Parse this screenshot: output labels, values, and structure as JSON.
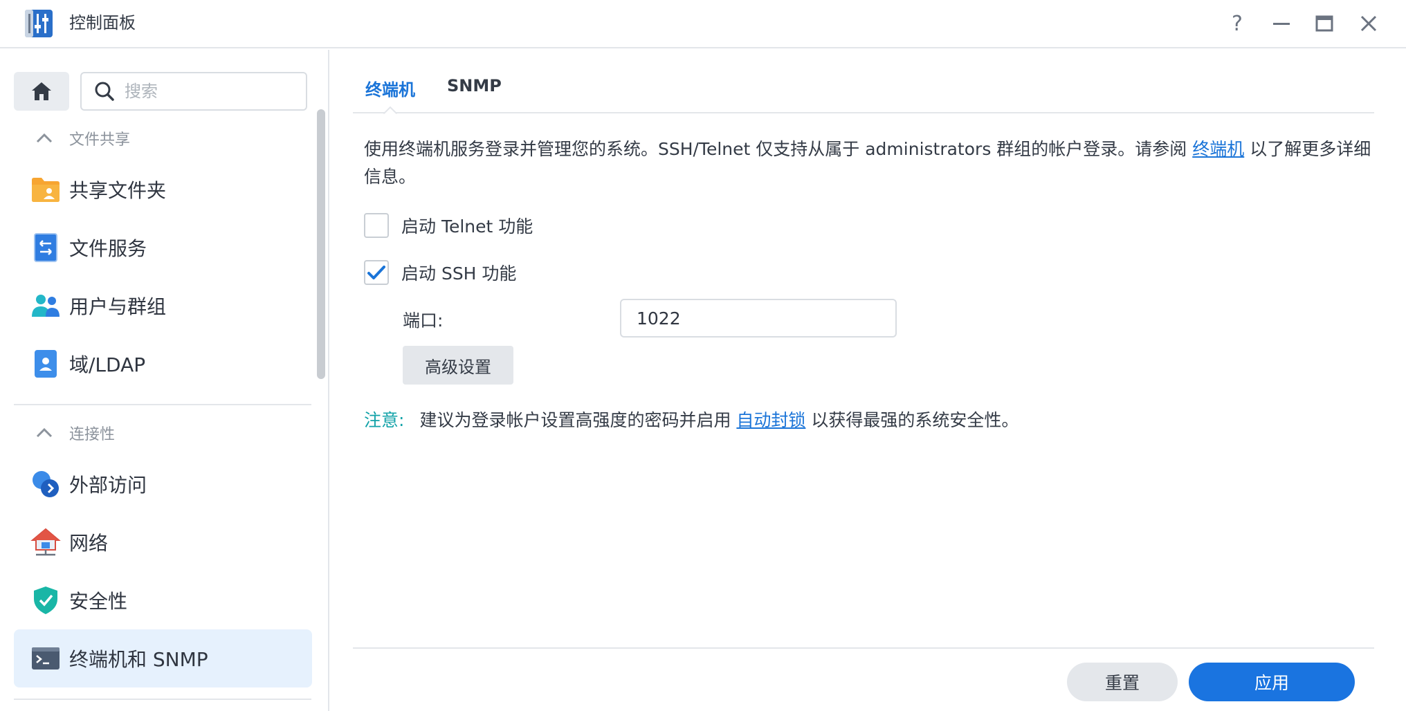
{
  "window": {
    "title": "控制面板",
    "controls": [
      "?",
      "minimize",
      "maximize",
      "close"
    ]
  },
  "sidebar": {
    "search_placeholder": "搜索",
    "groups": [
      {
        "label": "文件共享",
        "items": [
          {
            "label": "共享文件夹",
            "icon": "folder-share-icon"
          },
          {
            "label": "文件服务",
            "icon": "file-services-icon"
          },
          {
            "label": "用户与群组",
            "icon": "users-groups-icon"
          },
          {
            "label": "域/LDAP",
            "icon": "domain-ldap-icon"
          }
        ]
      },
      {
        "label": "连接性",
        "items": [
          {
            "label": "外部访问",
            "icon": "external-access-icon"
          },
          {
            "label": "网络",
            "icon": "network-icon"
          },
          {
            "label": "安全性",
            "icon": "security-shield-icon"
          },
          {
            "label": "终端机和 SNMP",
            "icon": "terminal-icon",
            "active": true
          }
        ]
      }
    ]
  },
  "tabs": [
    {
      "label": "终端机",
      "active": true
    },
    {
      "label": "SNMP",
      "active": false
    }
  ],
  "content": {
    "desc_part1": "使用终端机服务登录并管理您的系统。SSH/Telnet 仅支持从属于 administrators 群组的帐户登录。请参阅 ",
    "desc_link": "终端机",
    "desc_part2": " 以了解更多详细信息。",
    "telnet_label": "启动 Telnet 功能",
    "telnet_checked": false,
    "ssh_label": "启动 SSH 功能",
    "ssh_checked": true,
    "port_label": "端口:",
    "port_value": "1022",
    "advanced_button": "高级设置",
    "note_label": "注意:",
    "note_part1": "建议为登录帐户设置高强度的密码并启用 ",
    "note_link": "自动封锁",
    "note_part2": " 以获得最强的系统安全性。"
  },
  "footer": {
    "reset_label": "重置",
    "apply_label": "应用"
  },
  "colors": {
    "accent": "#1a74d8",
    "note": "#12a2a8",
    "active_bg": "#e6f1fd"
  }
}
